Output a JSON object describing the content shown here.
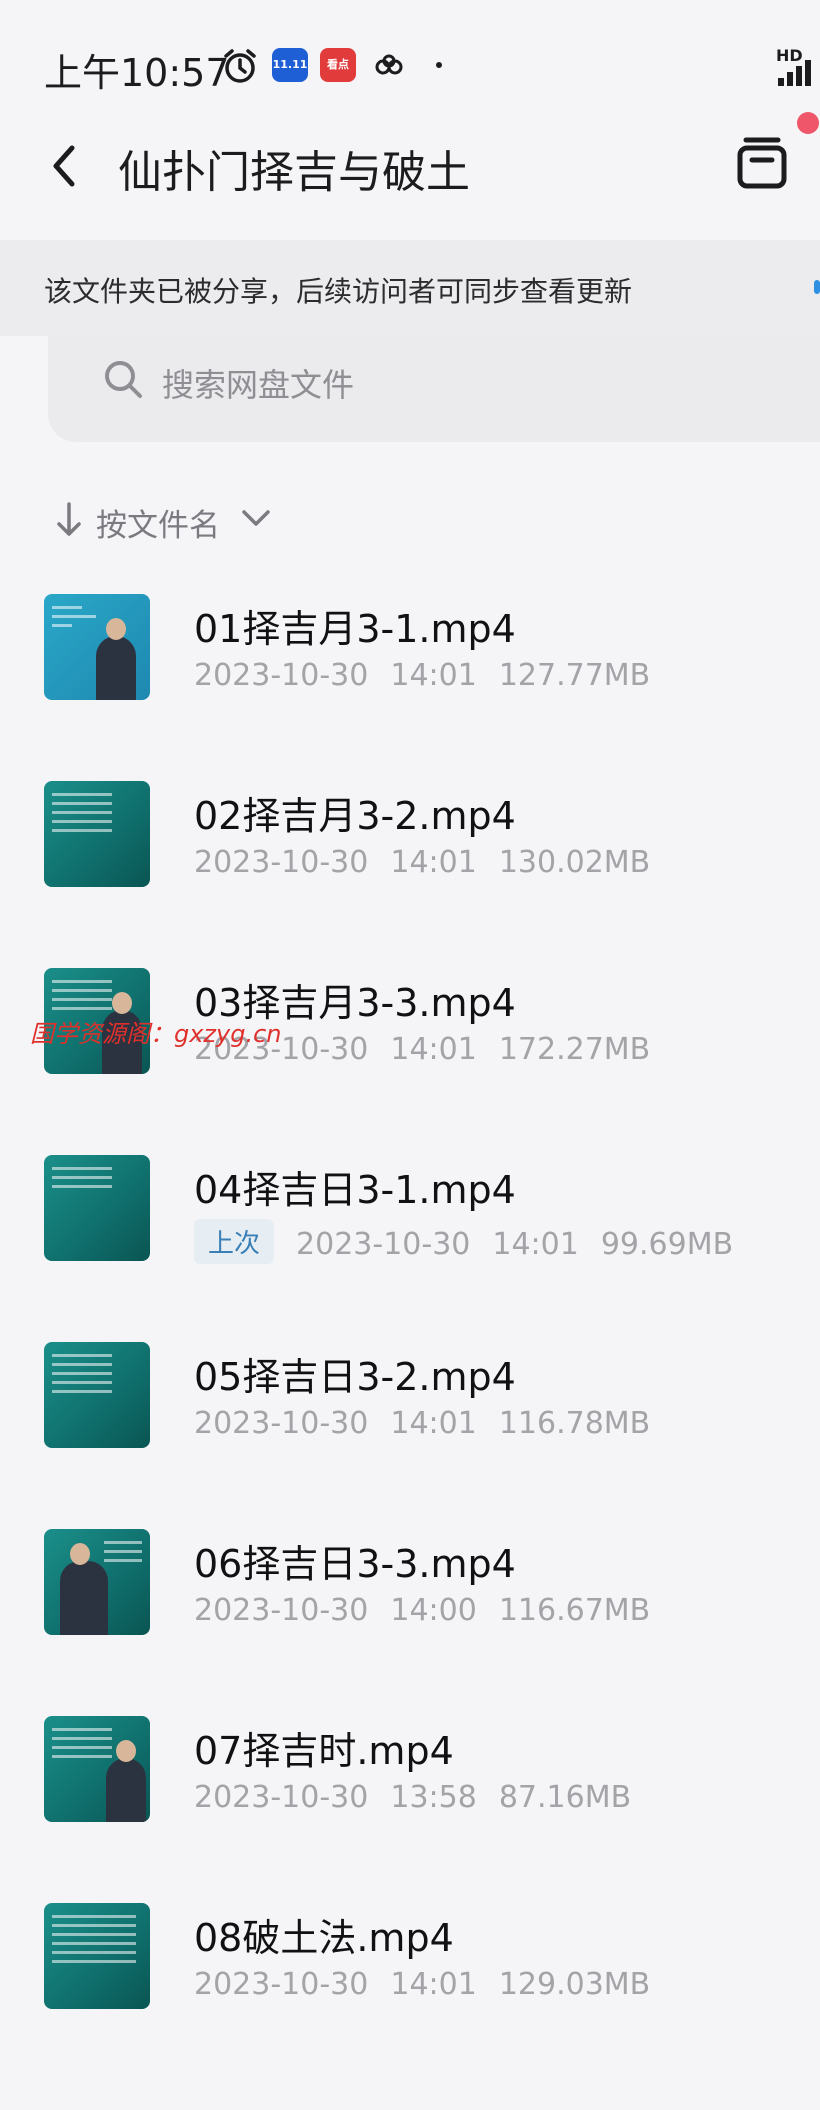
{
  "status_bar": {
    "time": "上午10:57",
    "app_badges": [
      "11.11",
      "看点"
    ],
    "hd": "HD",
    "icons": [
      "alarm-icon",
      "cloud-icon",
      "signal-icon"
    ]
  },
  "header": {
    "title": "仙扑门择吉与破土",
    "share_banner": "该文件夹已被分享，后续访问者可同步查看更新"
  },
  "search": {
    "placeholder": "搜索网盘文件"
  },
  "sort": {
    "label": "按文件名"
  },
  "watermark": "国学资源阁：gxzyg.cn",
  "files": [
    {
      "name": "01择吉月3-1.mp4",
      "date": "2023-10-30",
      "time": "14:01",
      "size": "127.77MB",
      "last": ""
    },
    {
      "name": "02择吉月3-2.mp4",
      "date": "2023-10-30",
      "time": "14:01",
      "size": "130.02MB",
      "last": ""
    },
    {
      "name": "03择吉月3-3.mp4",
      "date": "2023-10-30",
      "time": "14:01",
      "size": "172.27MB",
      "last": ""
    },
    {
      "name": "04择吉日3-1.mp4",
      "date": "2023-10-30",
      "time": "14:01",
      "size": "99.69MB",
      "last": "上次"
    },
    {
      "name": "05择吉日3-2.mp4",
      "date": "2023-10-30",
      "time": "14:01",
      "size": "116.78MB",
      "last": ""
    },
    {
      "name": "06择吉日3-3.mp4",
      "date": "2023-10-30",
      "time": "14:00",
      "size": "116.67MB",
      "last": ""
    },
    {
      "name": "07择吉时.mp4",
      "date": "2023-10-30",
      "time": "13:58",
      "size": "87.16MB",
      "last": ""
    },
    {
      "name": "08破土法.mp4",
      "date": "2023-10-30",
      "time": "14:01",
      "size": "129.03MB",
      "last": ""
    }
  ],
  "colors": {
    "background": "#f5f5f7",
    "accent": "#3a7fb6",
    "notification": "#f0566a",
    "watermark": "#e0302c"
  }
}
